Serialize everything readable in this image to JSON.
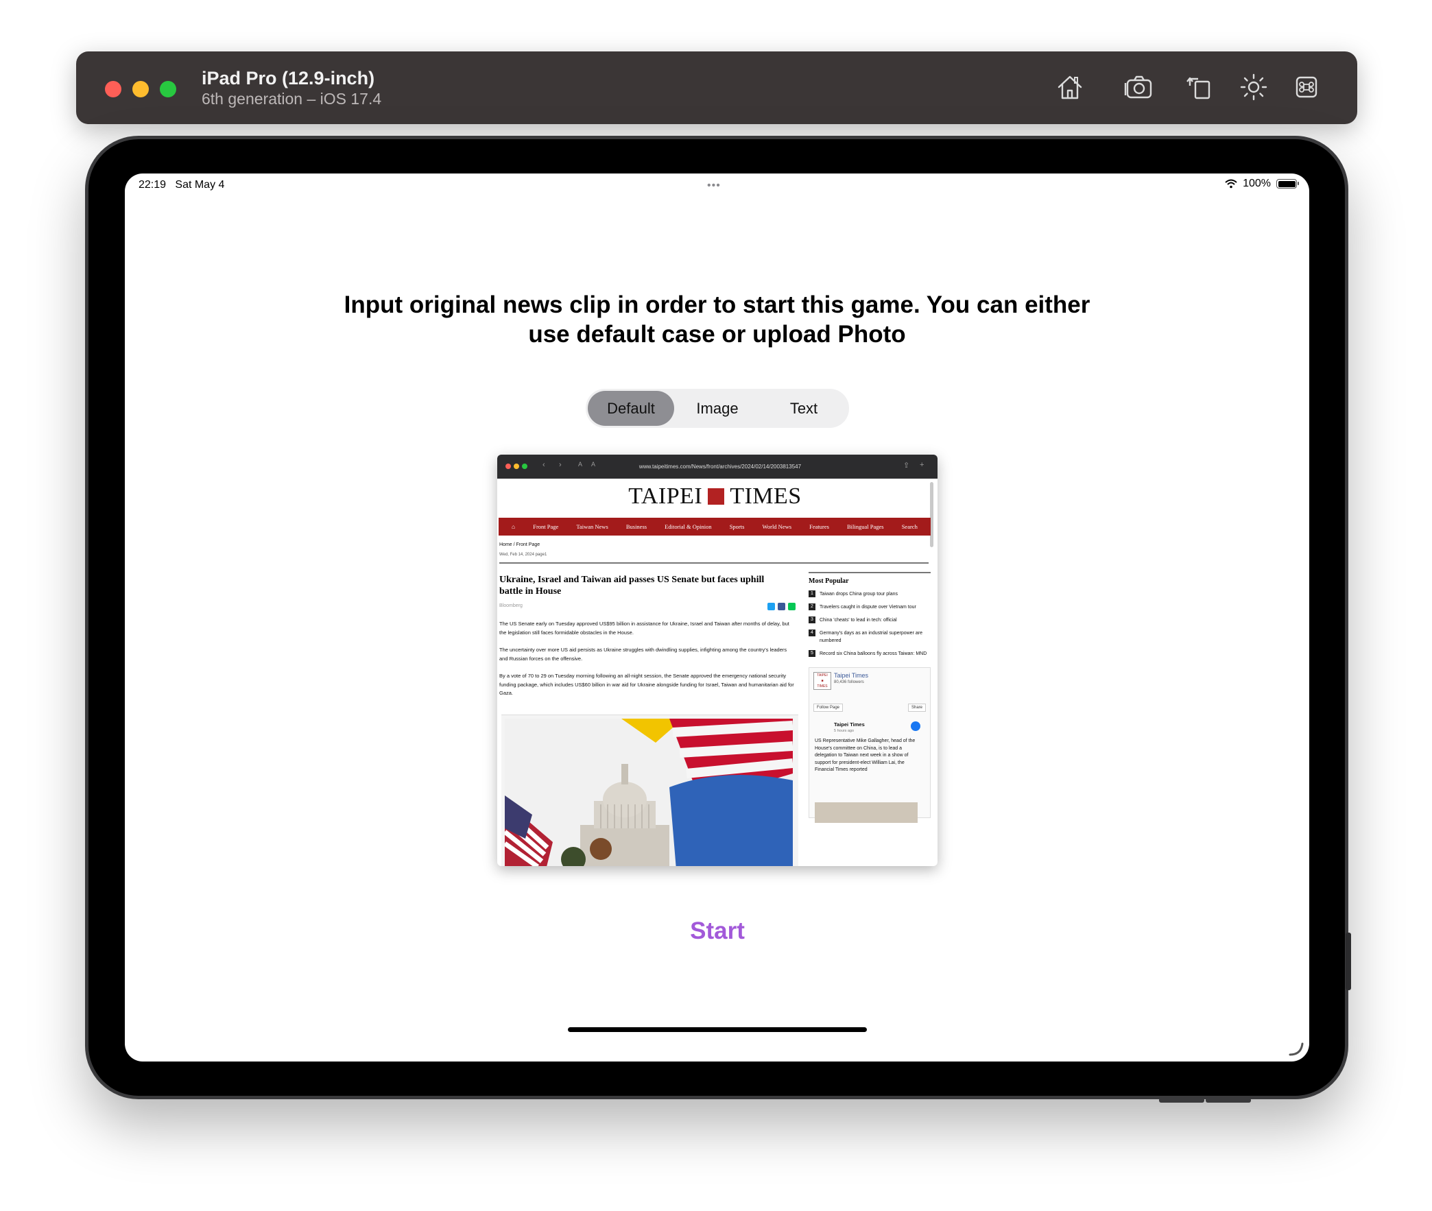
{
  "window": {
    "title": "iPad Pro (12.9-inch)",
    "subtitle": "6th generation – iOS 17.4",
    "toolbar": [
      "home-icon",
      "screenshot-icon",
      "rotate-icon",
      "appearance-icon",
      "command-icon"
    ]
  },
  "status_bar": {
    "time": "22:19",
    "date": "Sat May 4",
    "multitask": "•••",
    "battery": "100%"
  },
  "prompt": "Input original news clip in order to start this game. You can either use default case or upload Photo",
  "segmented": {
    "options": [
      "Default",
      "Image",
      "Text"
    ],
    "selected": "Default"
  },
  "preview": {
    "url": "www.taipeitimes.com/News/front/archives/2024/02/14/2003813547",
    "logo_left": "TAIPEI",
    "logo_right": "TIMES",
    "menu": [
      "Front Page",
      "Taiwan News",
      "Business",
      "Editorial & Opinion",
      "Sports",
      "World News",
      "Features",
      "Bilingual Pages",
      "Search"
    ],
    "breadcrumb": "Home / Front Page",
    "date": "Wed, Feb 14, 2024 page1",
    "headline": "Ukraine, Israel and Taiwan aid passes US Senate but faces uphill battle in House",
    "source": "Bloomberg",
    "paragraphs": [
      "The US Senate early on Tuesday approved US$95 billion in assistance for Ukraine, Israel and Taiwan after months of delay, but the legislation still faces formidable obstacles in the House.",
      "The uncertainty over more US aid persists as Ukraine struggles with dwindling supplies, infighting among the country's leaders and Russian forces on the offensive.",
      "By a vote of 70 to 29 on Tuesday morning following an all-night session, the Senate approved the emergency national security funding package, which includes US$60 billion in war aid for Ukraine alongside funding for Israel, Taiwan and humanitarian aid for Gaza."
    ],
    "most_popular_title": "Most Popular",
    "most_popular": [
      {
        "n": "1",
        "text": "Taiwan drops China group tour plans"
      },
      {
        "n": "2",
        "text": "Travelers caught in dispute over Vietnam tour"
      },
      {
        "n": "3",
        "text": "China 'cheats' to lead in tech: official"
      },
      {
        "n": "4",
        "text": "Germany's days as an industrial superpower are numbered"
      },
      {
        "n": "5",
        "text": "Record six China balloons fly across Taiwan: MND"
      }
    ],
    "fb": {
      "page_name": "Taipei Times",
      "followers": "80,436 followers",
      "follow_label": "Follow Page",
      "share_label": "Share",
      "post_name": "Taipei Times",
      "post_time": "5 hours ago",
      "post_text": "US Representative Mike Gallagher, head of the House's committee on China, is to lead a delegation to Taiwan next week in a show of support for president-elect William Lai, the Financial Times reported"
    }
  },
  "start_label": "Start",
  "colors": {
    "accent": "#a259d9",
    "titlebar": "#3b3636",
    "segment_active": "#8e8e93",
    "taipei_red": "#a31b1b"
  }
}
